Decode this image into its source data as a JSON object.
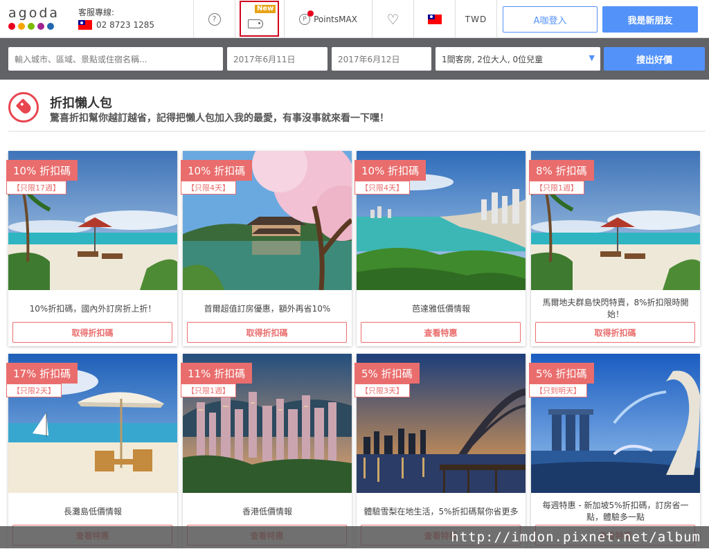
{
  "topbar": {
    "logo_text": "agoda",
    "logo_dot_colors": [
      "#e8001c",
      "#f6a500",
      "#7cbb00",
      "#a1248f",
      "#2067b0"
    ],
    "cs_label": "客服專線:",
    "cs_phone": "02 8723 1285",
    "help_icon_glyph": "?",
    "new_badge": "New",
    "pointsmax_label": "PointsMAX",
    "pointsmax_icon_glyph": "P",
    "currency": "TWD",
    "login_label": "A咖登入",
    "join_label": "我是新朋友"
  },
  "search": {
    "destination_placeholder": "輸入城市、區域、景點或住宿名稱...",
    "checkin": "2017年6月11日",
    "checkout": "2017年6月12日",
    "occupancy": "1間客房, 2位大人, 0位兒童",
    "submit_label": "搜出好價"
  },
  "section": {
    "title": "折扣懶人包",
    "subtitle": "驚喜折扣幫你越訂越省，記得把懶人包加入我的最愛，有事沒事就來看一下嘿！"
  },
  "cards": [
    {
      "badge": "10% 折扣碼",
      "sub": "【只限17週】",
      "title": "10%折扣碼，國內外訂房折上折！",
      "button": "取得折扣碼",
      "scene": "beach"
    },
    {
      "badge": "10% 折扣碼",
      "sub": "【只限4天】",
      "title": "首爾超值訂房優惠，額外再省10%",
      "button": "取得折扣碼",
      "scene": "korea"
    },
    {
      "badge": "10% 折扣碼",
      "sub": "【只限4天】",
      "title": "芭達雅低價情報",
      "button": "查看特惠",
      "scene": "pattaya"
    },
    {
      "badge": "8% 折扣碼",
      "sub": "【只限1週】",
      "title": "馬爾地夫群島快閃特賣，8%折扣限時開始！",
      "button": "取得折扣碼",
      "scene": "beach"
    },
    {
      "badge": "17% 折扣碼",
      "sub": "【只限2天】",
      "title": "長灘島低價情報",
      "button": "查看特惠",
      "scene": "boracay"
    },
    {
      "badge": "11% 折扣碼",
      "sub": "【只限1週】",
      "title": "香港低價情報",
      "button": "查看特惠",
      "scene": "hongkong"
    },
    {
      "badge": "5% 折扣碼",
      "sub": "【只限3天】",
      "title": "體驗雪梨在地生活，5%折扣碼幫你省更多",
      "button": "查看特惠",
      "scene": "sydney"
    },
    {
      "badge": "5% 折扣碼",
      "sub": "【只到明天】",
      "title": "每週特惠 - 新加坡5%折扣碼，訂房省一點，體驗多一點",
      "button": "查看特惠",
      "scene": "singapore"
    }
  ],
  "watermark": "http://imdon.pixnet.net/album",
  "colors": {
    "accent": "#5392f9",
    "promo": "#ea6d6d",
    "header_icon": "#e8454f",
    "searchbar": "#616367"
  }
}
